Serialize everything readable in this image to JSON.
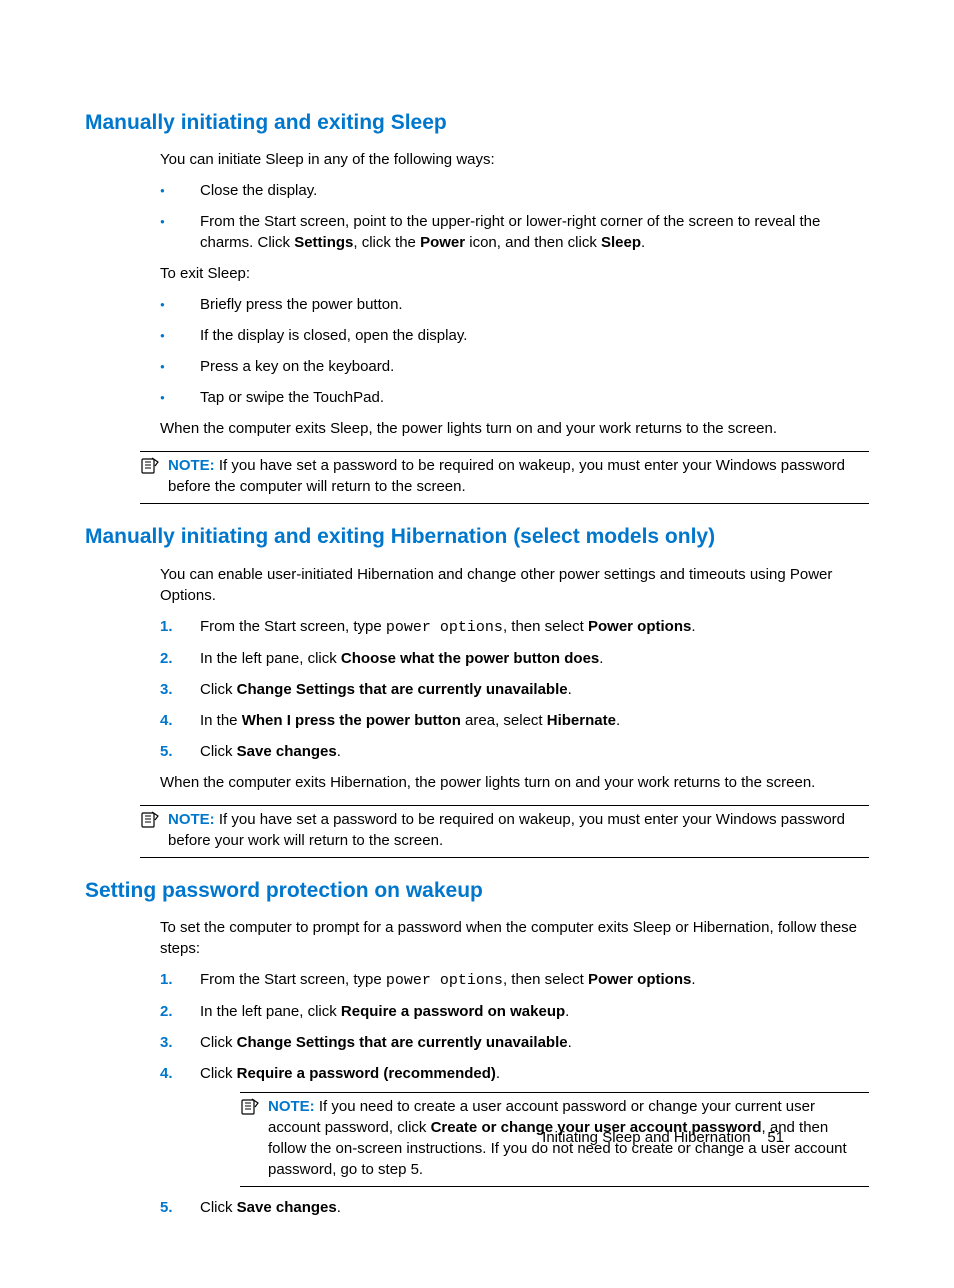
{
  "section1": {
    "heading": "Manually initiating and exiting Sleep",
    "intro": "You can initiate Sleep in any of the following ways:",
    "bullets1": {
      "b0": "Close the display.",
      "b1_pre": "From the Start screen, point to the upper-right or lower-right corner of the screen to reveal the charms. Click ",
      "b1_bold1": "Settings",
      "b1_mid1": ", click the ",
      "b1_bold2": "Power",
      "b1_mid2": " icon, and then click ",
      "b1_bold3": "Sleep",
      "b1_end": "."
    },
    "exit_intro": "To exit Sleep:",
    "bullets2": {
      "b0": "Briefly press the power button.",
      "b1": "If the display is closed, open the display.",
      "b2": "Press a key on the keyboard.",
      "b3": "Tap or swipe the TouchPad."
    },
    "after": "When the computer exits Sleep, the power lights turn on and your work returns to the screen.",
    "note_label": "NOTE:",
    "note_text": "If you have set a password to be required on wakeup, you must enter your Windows password before the computer will return to the screen."
  },
  "section2": {
    "heading": "Manually initiating and exiting Hibernation (select models only)",
    "intro": "You can enable user-initiated Hibernation and change other power settings and timeouts using Power Options.",
    "steps": {
      "s1_pre": "From the Start screen, type ",
      "s1_mono": "power options",
      "s1_mid": ", then select ",
      "s1_bold": "Power options",
      "s1_end": ".",
      "s2_pre": "In the left pane, click ",
      "s2_bold": "Choose what the power button does",
      "s2_end": ".",
      "s3_pre": "Click ",
      "s3_bold": "Change Settings that are currently unavailable",
      "s3_end": ".",
      "s4_pre": "In the ",
      "s4_bold1": "When I press the power button",
      "s4_mid": " area, select ",
      "s4_bold2": "Hibernate",
      "s4_end": ".",
      "s5_pre": "Click ",
      "s5_bold": "Save changes",
      "s5_end": "."
    },
    "after": "When the computer exits Hibernation, the power lights turn on and your work returns to the screen.",
    "note_label": "NOTE:",
    "note_text": "If you have set a password to be required on wakeup, you must enter your Windows password before your work will return to the screen."
  },
  "section3": {
    "heading": "Setting password protection on wakeup",
    "intro": "To set the computer to prompt for a password when the computer exits Sleep or Hibernation, follow these steps:",
    "steps": {
      "s1_pre": "From the Start screen, type ",
      "s1_mono": "power options",
      "s1_mid": ", then select ",
      "s1_bold": "Power options",
      "s1_end": ".",
      "s2_pre": "In the left pane, click ",
      "s2_bold": "Require a password on wakeup",
      "s2_end": ".",
      "s3_pre": "Click ",
      "s3_bold": "Change Settings that are currently unavailable",
      "s3_end": ".",
      "s4_pre": "Click ",
      "s4_bold": "Require a password (recommended)",
      "s4_end": ".",
      "note_label": "NOTE:",
      "note_text_pre": "If you need to create a user account password or change your current user account password, click ",
      "note_text_bold": "Create or change your user account password",
      "note_text_post": ", and then follow the on-screen instructions. If you do not need to create or change a user account password, go to step 5.",
      "s5_pre": "Click ",
      "s5_bold": "Save changes",
      "s5_end": "."
    }
  },
  "footer": {
    "text": "Initiating Sleep and Hibernation",
    "page": "51"
  }
}
